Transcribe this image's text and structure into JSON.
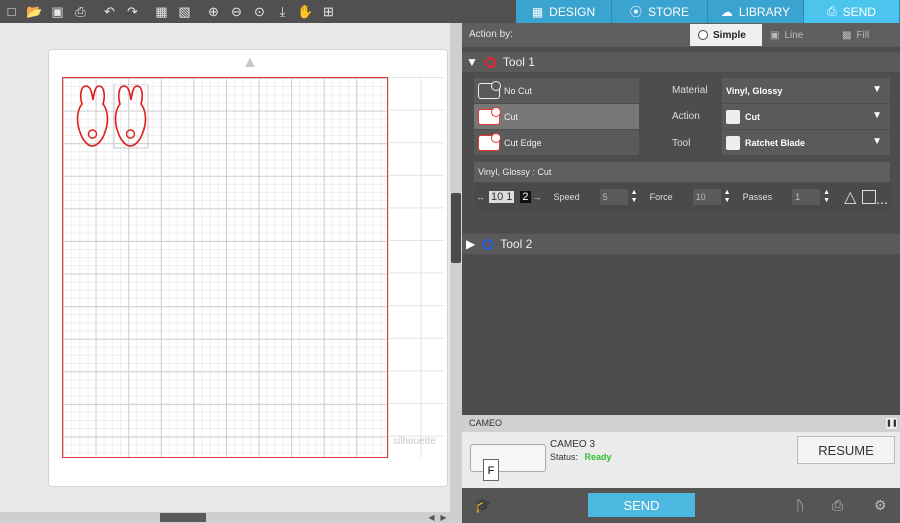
{
  "toolbar": {
    "icons": [
      "new-page-icon",
      "open-folder-icon",
      "save-icon",
      "print-icon",
      "undo-icon",
      "redo-icon",
      "select-all-icon",
      "deselect-icon",
      "zoom-in-icon",
      "zoom-out-icon",
      "zoom-fit-icon",
      "pan-down-icon",
      "hand-icon",
      "add-box-icon"
    ]
  },
  "tabs": [
    {
      "label": "DESIGN",
      "icon": "grid-icon"
    },
    {
      "label": "STORE",
      "icon": "compass-icon"
    },
    {
      "label": "LIBRARY",
      "icon": "cloud-icon"
    },
    {
      "label": "SEND",
      "icon": "printer-icon",
      "active": true
    }
  ],
  "canvas": {
    "watermark": "silhouette"
  },
  "action_by": {
    "label": "Action by:",
    "options": [
      "Simple",
      "Line",
      "Fill"
    ],
    "selected": "Simple"
  },
  "tool1": {
    "title": "Tool 1",
    "color": "#e22222",
    "cut_options": [
      "No Cut",
      "Cut",
      "Cut Edge"
    ],
    "selected_cut": "Cut",
    "material_label": "Material",
    "material_value": "Vinyl, Glossy",
    "action_label": "Action",
    "action_value": "Cut",
    "tool_label": "Tool",
    "tool_value": "Ratchet Blade",
    "summary": "Vinyl, Glossy : Cut",
    "blade_value": "10 1",
    "blade_value2": "2",
    "speed_label": "Speed",
    "speed_value": "5",
    "force_label": "Force",
    "force_value": "10",
    "passes_label": "Passes",
    "passes_value": "1"
  },
  "tool2": {
    "title": "Tool 2",
    "color": "#2b5be6"
  },
  "device": {
    "header": "CAMEO",
    "name": "CAMEO 3",
    "status_label": "Status:",
    "status_value": "Ready",
    "resume_label": "RESUME",
    "send_label": "SEND",
    "feed_letter": "F"
  }
}
